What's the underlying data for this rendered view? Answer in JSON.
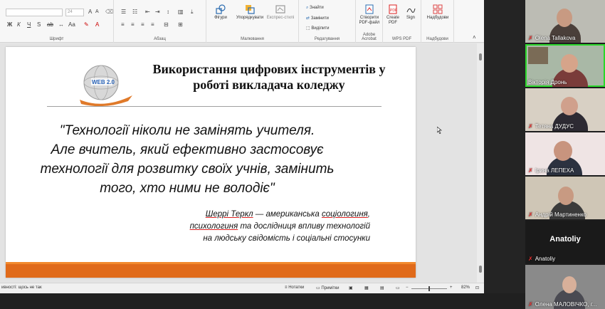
{
  "ribbon": {
    "font_size_value": "24",
    "groups": {
      "font": "Шрифт",
      "paragraph": "Абзац",
      "drawing": "Малювання",
      "editing": "Редагування",
      "adobe": "Adobe Acrobat",
      "wps": "WPS PDF",
      "addins": "Надбудови"
    },
    "buttons": {
      "shapes": "Фігури",
      "arrange": "Упорядкувати",
      "quick_styles": "Експрес-стилі",
      "find": "Знайти",
      "replace": "Замінити",
      "select": "Виділити",
      "create_pdf": "Створити PDF-файл",
      "create_pdf_wps": "Create PDF",
      "sign": "Sign",
      "addins": "Надбудови"
    }
  },
  "slide": {
    "title": "Використання цифрових інструментів у роботі викладача коледжу",
    "quote_lines": [
      "\"Технології ніколи не замінять учителя.",
      "Але вчитель, який ефективно застосовує",
      "технології для розвитку своїх учнів, замінить",
      "того, хто ними не володіє\""
    ],
    "attribution": {
      "author": "Шеррі Теркл",
      "line1_rest": " — американська ",
      "line1_u": "соціологиня",
      "line1_end": ",",
      "line2_u": "психологиня",
      "line2_rest": " та дослідниця впливу технологій",
      "line3": "на людську свідомість і соціальні стосунки"
    },
    "logo_text": "WEB 2.0"
  },
  "statusbar": {
    "left_text": "ивності: щось не так",
    "notes": "Нотатки",
    "comments": "Примітки",
    "zoom": "82%"
  },
  "participants": [
    {
      "name": "Olena Tallakova",
      "muted": true,
      "active": false
    },
    {
      "name": "Вікторія Дронь",
      "muted": false,
      "active": true
    },
    {
      "name": "Тетяна ДУДУС",
      "muted": true,
      "active": false
    },
    {
      "name": "Ірина ЛЕПЕХА",
      "muted": true,
      "active": false
    },
    {
      "name": "Андрій Мартиненко",
      "muted": true,
      "active": false
    },
    {
      "name": "Anatoliy",
      "muted": true,
      "active": false,
      "avatar_text": "Anatoliy"
    },
    {
      "name": "Олена МАЛОВІЧКО, г...",
      "muted": true,
      "active": false
    }
  ],
  "colors": {
    "accent_orange": "#e06a1a",
    "active_speaker": "#2bd62b",
    "muted_icon": "#e33333"
  }
}
